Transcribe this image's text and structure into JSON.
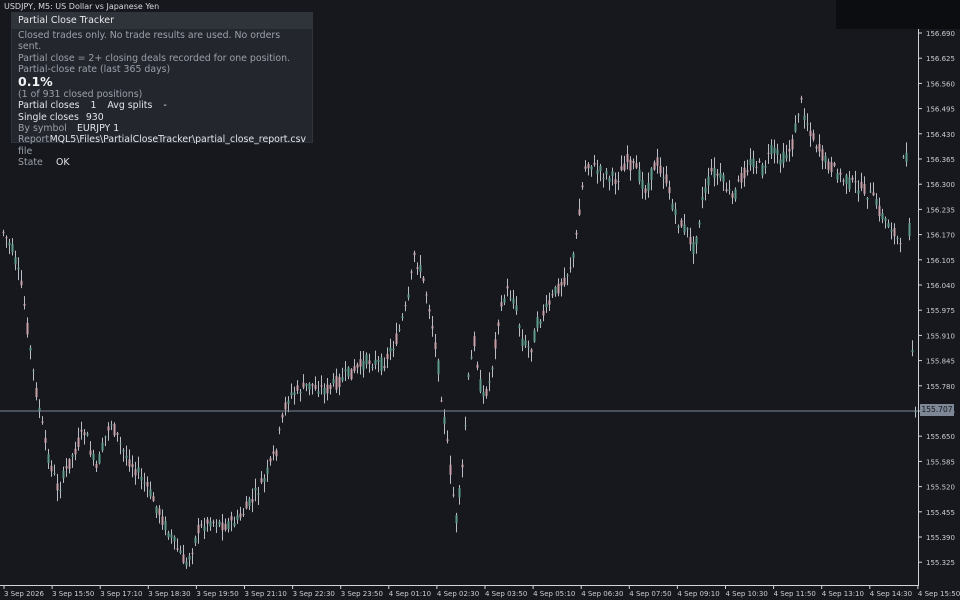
{
  "chart": {
    "title": "USDJPY, M5:  US Dollar vs Japanese Yen",
    "current_price": "155.707",
    "price_axis": [
      "156.690",
      "156.625",
      "156.560",
      "156.495",
      "156.430",
      "156.365",
      "156.300",
      "156.235",
      "156.170",
      "156.105",
      "156.040",
      "155.975",
      "155.910",
      "155.845",
      "155.780",
      "155.715",
      "155.650",
      "155.585",
      "155.520",
      "155.455",
      "155.390",
      "155.325"
    ],
    "time_axis": [
      "3 Sep 2026",
      "3 Sep 15:50",
      "3 Sep 17:10",
      "3 Sep 18:30",
      "3 Sep 19:50",
      "3 Sep 21:10",
      "3 Sep 22:30",
      "3 Sep 23:50",
      "4 Sep 01:10",
      "4 Sep 02:30",
      "4 Sep 03:50",
      "4 Sep 05:10",
      "4 Sep 06:30",
      "4 Sep 07:50",
      "4 Sep 09:10",
      "4 Sep 10:30",
      "4 Sep 11:50",
      "4 Sep 13:10",
      "4 Sep 14:30",
      "4 Sep 15:50"
    ],
    "colors": {
      "background": "#16181d",
      "up_candle": "#5f9b8c",
      "down_candle": "#c8a0a8",
      "wick": "#b8bcc4",
      "price_line": "#7d8796"
    }
  },
  "panel": {
    "title": "Partial Close Tracker",
    "line1": "Closed trades only. No trade results are used. No orders sent.",
    "line2": "Partial close = 2+ closing deals recorded for one position.",
    "rate_label": "Partial-close rate (last 365 days)",
    "rate_value": "0.1%",
    "rate_detail": "(1 of 931 closed positions)",
    "partial_closes_label": "Partial closes",
    "partial_closes_value": "1",
    "avg_splits_label": "Avg splits",
    "avg_splits_value": "-",
    "single_closes_label": "Single closes",
    "single_closes_value": "930",
    "by_symbol_label": "By symbol",
    "by_symbol_value": "EURJPY 1",
    "report_file_label": "Report file",
    "report_file_value": "MQL5\\Files\\PartialCloseTracker\\partial_close_report.csv",
    "state_label": "State",
    "state_value": "OK"
  }
}
